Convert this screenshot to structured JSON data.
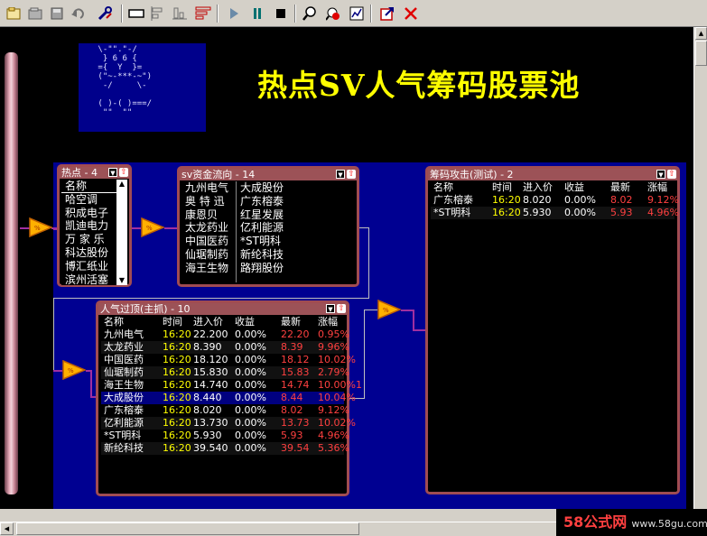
{
  "toolbar": {
    "icons": [
      "new-icon",
      "open-icon",
      "save-icon",
      "undo-icon",
      "tools-icon",
      "rect-icon",
      "align-left-icon",
      "align-bottom-icon",
      "format-icon",
      "play-icon",
      "pause-icon",
      "stop-icon",
      "zoom-icon",
      "search-doc-icon",
      "chart-icon",
      "export-icon",
      "close-icon"
    ]
  },
  "ascii_art": " \\-\"\".\"-/\n  } 6 6 {\n ={  Y  }=\n (\"~-***-~\")\n  -/     \\-\n\n ( )-( )===/\n  \"\"  \"\"",
  "title": "热点SV人气筹码股票池",
  "hot": {
    "header": "热点 - 4",
    "column": "名称",
    "items": [
      "哈空调",
      "积成电子",
      "凯迪电力",
      "万 家 乐",
      "科达股份",
      "博汇纸业",
      "滨州活塞"
    ]
  },
  "sv": {
    "header": "sv资金流向 - 14",
    "col1": [
      "九州电气",
      "奥 特 迅",
      "康恩贝",
      "太龙药业",
      "中国医药",
      "仙琚制药",
      "海王生物"
    ],
    "col2": [
      "大成股份",
      "广东榕泰",
      "红星发展",
      "亿利能源",
      "*ST明科",
      "新纶科技",
      "路翔股份"
    ]
  },
  "popular": {
    "header": "人气过顶(主抓) - 10",
    "columns": [
      "名称",
      "时间",
      "进入价",
      "收益",
      "最新",
      "涨幅"
    ],
    "rows": [
      [
        "九州电气",
        "16:20",
        "22.200",
        "0.00%",
        "22.20",
        "0.95%"
      ],
      [
        "太龙药业",
        "16:20",
        "8.390",
        "0.00%",
        "8.39",
        "9.96%"
      ],
      [
        "中国医药",
        "16:20",
        "18.120",
        "0.00%",
        "18.12",
        "10.02%"
      ],
      [
        "仙琚制药",
        "16:20",
        "15.830",
        "0.00%",
        "15.83",
        "2.79%"
      ],
      [
        "海王生物",
        "16:20",
        "14.740",
        "0.00%",
        "14.74",
        "10.00%1"
      ],
      [
        "大成股份",
        "16:20",
        "8.440",
        "0.00%",
        "8.44",
        "10.04%"
      ],
      [
        "广东榕泰",
        "16:20",
        "8.020",
        "0.00%",
        "8.02",
        "9.12%"
      ],
      [
        "亿利能源",
        "16:20",
        "13.730",
        "0.00%",
        "13.73",
        "10.02%"
      ],
      [
        "*ST明科",
        "16:20",
        "5.930",
        "0.00%",
        "5.93",
        "4.96%"
      ],
      [
        "新纶科技",
        "16:20",
        "39.540",
        "0.00%",
        "39.54",
        "5.36%"
      ]
    ],
    "selected_index": 5
  },
  "chip": {
    "header": "筹码攻击(测试) - 2",
    "columns": [
      "名称",
      "时间",
      "进入价",
      "收益",
      "最新",
      "涨幅"
    ],
    "rows": [
      [
        "广东榕泰",
        "16:20",
        "8.020",
        "0.00%",
        "8.02",
        "9.12%"
      ],
      [
        "*ST明科",
        "16:20",
        "5.930",
        "0.00%",
        "5.93",
        "4.96%"
      ]
    ]
  },
  "logo": {
    "brand": "58公式网",
    "url": "www.58gu.com"
  },
  "colors": {
    "accent_red": "#ff4040",
    "time_yellow": "#ffff00",
    "panel_border": "#a04c52",
    "canvas_blue": "#000091",
    "title_yellow": "#ffff00"
  }
}
